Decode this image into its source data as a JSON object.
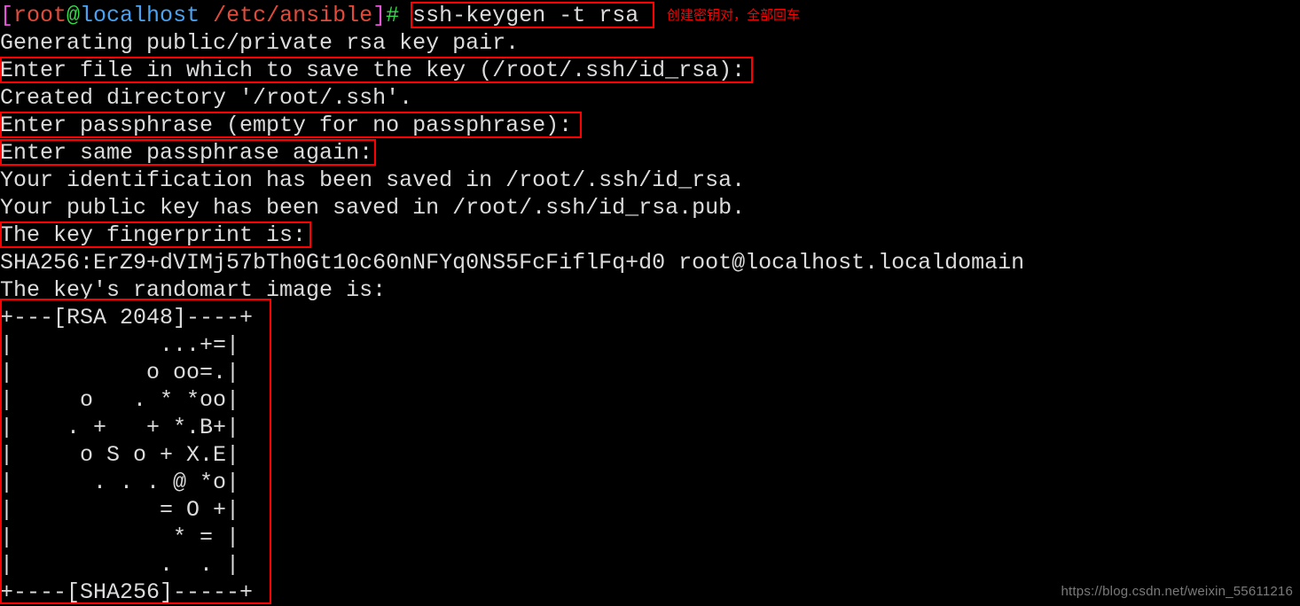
{
  "terminal": {
    "background_color": "#000000",
    "foreground_color": "#dcdcdc",
    "prompt": {
      "open_bracket": "[",
      "user": "root",
      "at": "@",
      "host": "localhost",
      "space": " ",
      "path": "/etc/ansible",
      "close_bracket": "]",
      "hash": "#",
      "colors": {
        "bracket": "#e357d6",
        "user": "#e24a3a",
        "at": "#35d94a",
        "host": "#4aa3f0",
        "path": "#e24a3a",
        "hash": "#35d94a"
      }
    },
    "command": "ssh-keygen -t rsa",
    "output_lines": [
      "Generating public/private rsa key pair.",
      "Enter file in which to save the key (/root/.ssh/id_rsa): ",
      "Created directory '/root/.ssh'.",
      "Enter passphrase (empty for no passphrase): ",
      "Enter same passphrase again: ",
      "Your identification has been saved in /root/.ssh/id_rsa.",
      "Your public key has been saved in /root/.ssh/id_rsa.pub.",
      "The key fingerprint is:",
      "SHA256:ErZ9+dVIMj57bTh0Gt10c60nNFYq0NS5FcFiflFq+d0 root@localhost.localdomain",
      "The key's randomart image is:"
    ],
    "randomart": {
      "header": "+---[RSA 2048]----+",
      "rows": [
        "|           ...+=|",
        "|          o oo=.|",
        "|     o   . * *oo|",
        "|    . +   + *.B+|",
        "|     o S o + X.E|",
        "|      . . . @ *o|",
        "|           = O +|",
        "|            * = |",
        "|           .  . |"
      ],
      "footer": "+----[SHA256]-----+"
    }
  },
  "annotations": {
    "command_note": "创建密钥对，全部回车",
    "note_color": "#ff0000",
    "box_color": "#ff0000",
    "highlight_boxes": [
      "command",
      "enter-file-prompt",
      "enter-passphrase-prompt",
      "enter-same-passphrase-prompt",
      "key-fingerprint-label",
      "randomart-block"
    ]
  },
  "watermark": {
    "text": "https://blog.csdn.net/weixin_55611216"
  }
}
